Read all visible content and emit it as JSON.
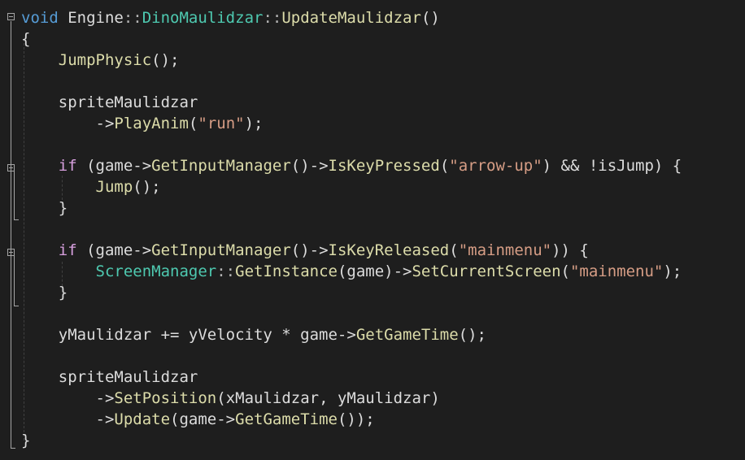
{
  "editor": {
    "lines": [
      {
        "tokens": [
          {
            "t": "void",
            "c": "kw"
          },
          {
            "t": " Engine",
            "c": "var"
          },
          {
            "t": "::",
            "c": "op"
          },
          {
            "t": "DinoMaulidzar",
            "c": "ty"
          },
          {
            "t": "::",
            "c": "op"
          },
          {
            "t": "UpdateMaulidzar",
            "c": "fn"
          },
          {
            "t": "()",
            "c": "punc"
          }
        ]
      },
      {
        "tokens": [
          {
            "t": "{",
            "c": "punc"
          }
        ]
      },
      {
        "tokens": [
          {
            "t": "    ",
            "c": "punc"
          },
          {
            "t": "JumpPhysic",
            "c": "fn"
          },
          {
            "t": "();",
            "c": "punc"
          }
        ]
      },
      {
        "tokens": []
      },
      {
        "tokens": [
          {
            "t": "    ",
            "c": "punc"
          },
          {
            "t": "spriteMaulidzar",
            "c": "var"
          }
        ]
      },
      {
        "tokens": [
          {
            "t": "        ",
            "c": "punc"
          },
          {
            "t": "->",
            "c": "punc"
          },
          {
            "t": "PlayAnim",
            "c": "fn"
          },
          {
            "t": "(",
            "c": "punc"
          },
          {
            "t": "\"run\"",
            "c": "str"
          },
          {
            "t": ");",
            "c": "punc"
          }
        ]
      },
      {
        "tokens": []
      },
      {
        "tokens": [
          {
            "t": "    ",
            "c": "punc"
          },
          {
            "t": "if",
            "c": "ctl"
          },
          {
            "t": " (game->",
            "c": "punc"
          },
          {
            "t": "GetInputManager",
            "c": "fn"
          },
          {
            "t": "()->",
            "c": "punc"
          },
          {
            "t": "IsKeyPressed",
            "c": "fn"
          },
          {
            "t": "(",
            "c": "punc"
          },
          {
            "t": "\"arrow-up\"",
            "c": "str"
          },
          {
            "t": ") && !isJump) {",
            "c": "punc"
          }
        ]
      },
      {
        "tokens": [
          {
            "t": "        ",
            "c": "punc"
          },
          {
            "t": "Jump",
            "c": "fn"
          },
          {
            "t": "();",
            "c": "punc"
          }
        ]
      },
      {
        "tokens": [
          {
            "t": "    ",
            "c": "punc"
          },
          {
            "t": "}",
            "c": "punc"
          }
        ]
      },
      {
        "tokens": []
      },
      {
        "tokens": [
          {
            "t": "    ",
            "c": "punc"
          },
          {
            "t": "if",
            "c": "ctl"
          },
          {
            "t": " (game->",
            "c": "punc"
          },
          {
            "t": "GetInputManager",
            "c": "fn"
          },
          {
            "t": "()->",
            "c": "punc"
          },
          {
            "t": "IsKeyReleased",
            "c": "fn"
          },
          {
            "t": "(",
            "c": "punc"
          },
          {
            "t": "\"mainmenu\"",
            "c": "str"
          },
          {
            "t": ")) {",
            "c": "punc"
          }
        ]
      },
      {
        "tokens": [
          {
            "t": "        ",
            "c": "punc"
          },
          {
            "t": "ScreenManager",
            "c": "ty"
          },
          {
            "t": "::",
            "c": "op"
          },
          {
            "t": "GetInstance",
            "c": "fn"
          },
          {
            "t": "(game)->",
            "c": "punc"
          },
          {
            "t": "SetCurrentScreen",
            "c": "fn"
          },
          {
            "t": "(",
            "c": "punc"
          },
          {
            "t": "\"mainmenu\"",
            "c": "str"
          },
          {
            "t": ");",
            "c": "punc"
          }
        ]
      },
      {
        "tokens": [
          {
            "t": "    ",
            "c": "punc"
          },
          {
            "t": "}",
            "c": "punc"
          }
        ]
      },
      {
        "tokens": []
      },
      {
        "tokens": [
          {
            "t": "    ",
            "c": "punc"
          },
          {
            "t": "yMaulidzar += yVelocity * game->",
            "c": "var"
          },
          {
            "t": "GetGameTime",
            "c": "fn"
          },
          {
            "t": "();",
            "c": "punc"
          }
        ]
      },
      {
        "tokens": []
      },
      {
        "tokens": [
          {
            "t": "    ",
            "c": "punc"
          },
          {
            "t": "spriteMaulidzar",
            "c": "var"
          }
        ]
      },
      {
        "tokens": [
          {
            "t": "        ",
            "c": "punc"
          },
          {
            "t": "->",
            "c": "punc"
          },
          {
            "t": "SetPosition",
            "c": "fn"
          },
          {
            "t": "(xMaulidzar, yMaulidzar)",
            "c": "punc"
          }
        ]
      },
      {
        "tokens": [
          {
            "t": "        ",
            "c": "punc"
          },
          {
            "t": "->",
            "c": "punc"
          },
          {
            "t": "Update",
            "c": "fn"
          },
          {
            "t": "(game->",
            "c": "punc"
          },
          {
            "t": "GetGameTime",
            "c": "fn"
          },
          {
            "t": "());",
            "c": "punc"
          }
        ]
      },
      {
        "tokens": [
          {
            "t": "}",
            "c": "punc"
          }
        ]
      }
    ]
  }
}
